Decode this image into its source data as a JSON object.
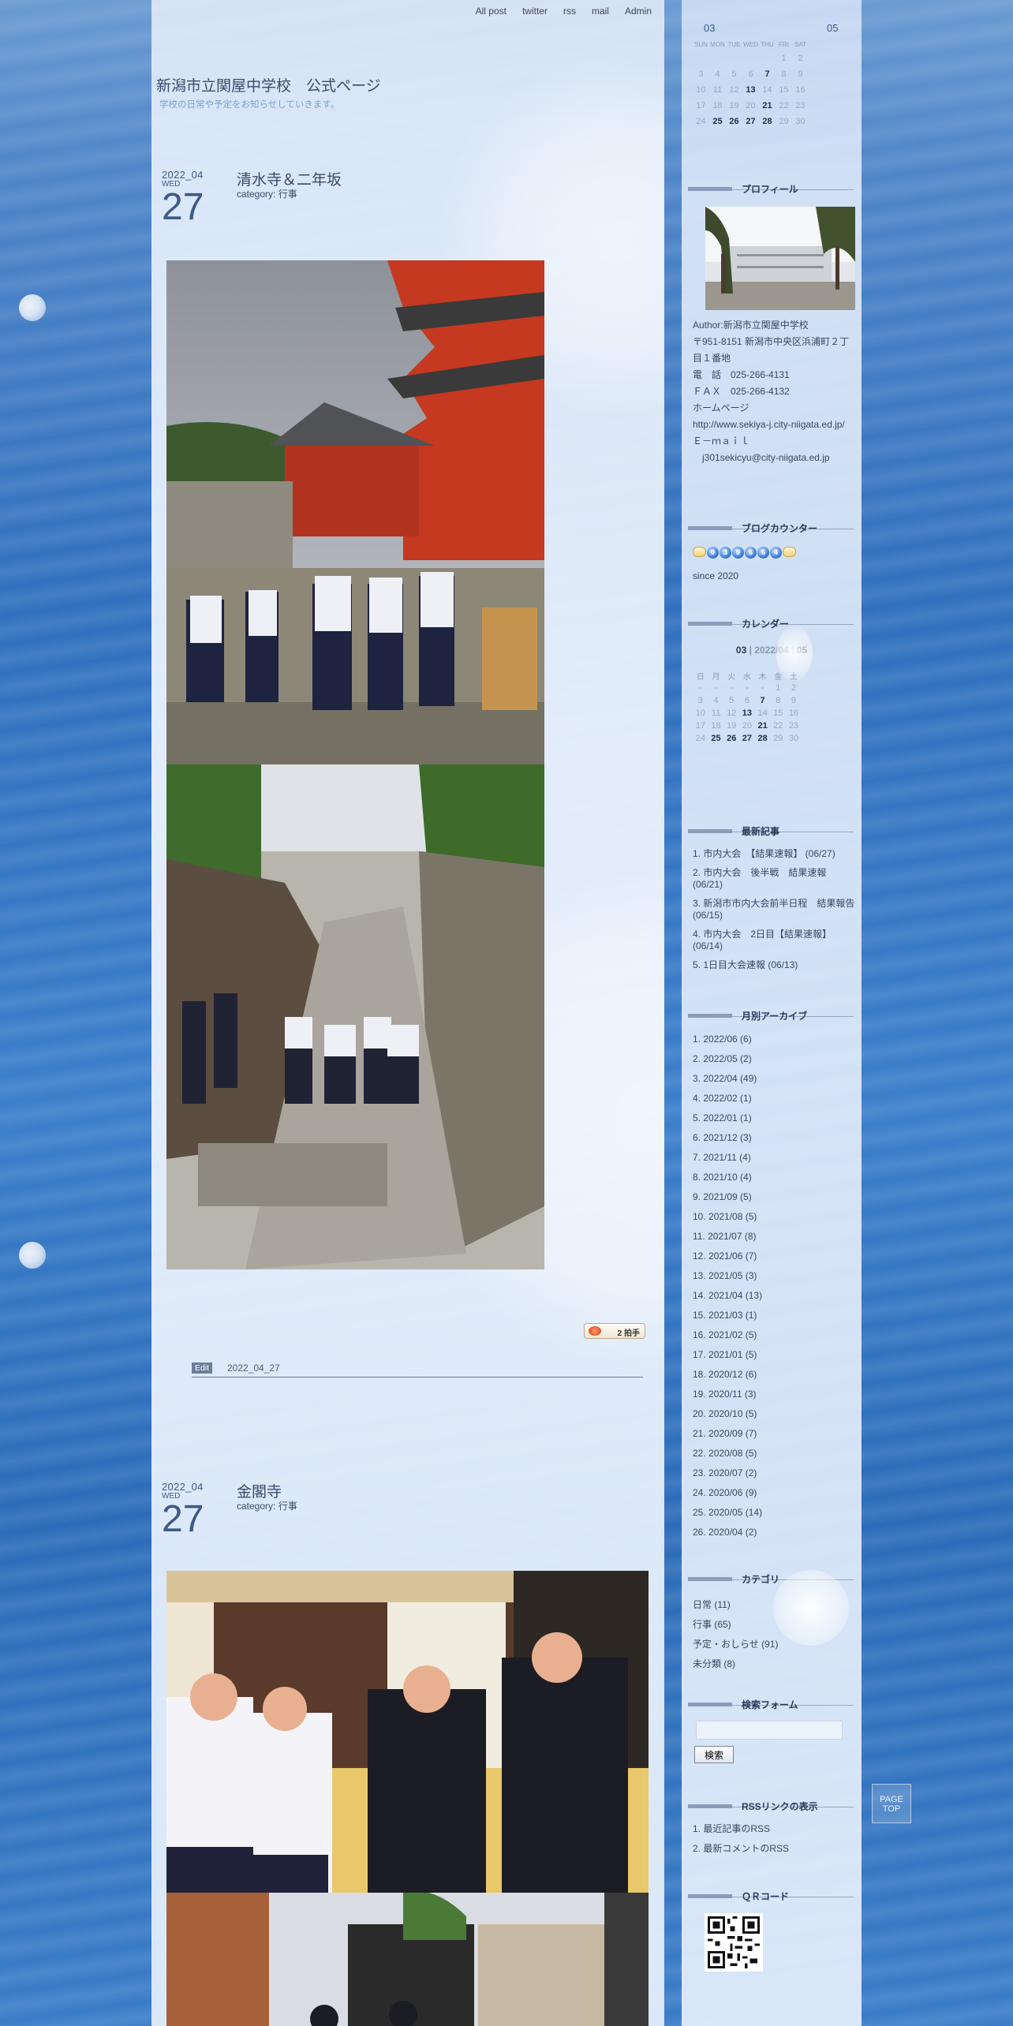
{
  "nav": [
    "All post",
    "twitter",
    "rss",
    "mail",
    "Admin"
  ],
  "site": {
    "title": "新潟市立関屋中学校　公式ページ",
    "subtitle": "学校の日常や予定をお知らせしていきます。"
  },
  "entries": [
    {
      "year_month": "2022_04",
      "weekday": "WED",
      "day": "27",
      "title": "清水寺＆二年坂",
      "category": "category: 行事",
      "counter": "2",
      "counter_unit": "拍手",
      "edit_label": "Edit",
      "footer_date": "2022_04_27"
    },
    {
      "year_month": "2022_04",
      "weekday": "WED",
      "day": "27",
      "title": "金閣寺",
      "category": "category: 行事"
    }
  ],
  "top_calendar": {
    "prev": "03",
    "next": "05",
    "weekdays": [
      "SUN",
      "MON",
      "TUE",
      "WED",
      "THU",
      "FRI",
      "SAT"
    ],
    "rows": [
      [
        "",
        "",
        "",
        "",
        "",
        "1",
        "2"
      ],
      [
        "3",
        "4",
        "5",
        "6",
        "7",
        "8",
        "9"
      ],
      [
        "10",
        "11",
        "12",
        "13",
        "14",
        "15",
        "16"
      ],
      [
        "17",
        "18",
        "19",
        "20",
        "21",
        "22",
        "23"
      ],
      [
        "24",
        "25",
        "26",
        "27",
        "28",
        "29",
        "30"
      ]
    ],
    "bold": [
      "7",
      "13",
      "21",
      "25",
      "26",
      "27",
      "28"
    ]
  },
  "sidebar": {
    "profile": {
      "heading": "プロフィール",
      "lines": [
        "Author:新潟市立関屋中学校",
        "〒951-8151 新潟市中央区浜浦町２丁目１番地",
        "電　話　025-266-4131",
        "ＦＡＸ　025-266-4132",
        "ホームページ",
        "http://www.sekiya-j.city-niigata.ed.jp/",
        "Ｅ－ｍａｉｌ",
        "　j301sekicyu@city-niigata.ed.jp"
      ]
    },
    "counter": {
      "heading": "ブログカウンター",
      "digits": [
        "0",
        "3",
        "9",
        "6",
        "6",
        "4"
      ],
      "since": "since 2020"
    },
    "calendar": {
      "heading": "カレンダー",
      "prev": "03",
      "current": "2022/04",
      "next": "05",
      "sep": "|",
      "weekdays": [
        "日",
        "月",
        "火",
        "水",
        "木",
        "金",
        "土"
      ],
      "rows": [
        [
          "-",
          "-",
          "-",
          "-",
          "-",
          "1",
          "2"
        ],
        [
          "3",
          "4",
          "5",
          "6",
          "7",
          "8",
          "9"
        ],
        [
          "10",
          "11",
          "12",
          "13",
          "14",
          "15",
          "16"
        ],
        [
          "17",
          "18",
          "19",
          "20",
          "21",
          "22",
          "23"
        ],
        [
          "24",
          "25",
          "26",
          "27",
          "28",
          "29",
          "30"
        ]
      ],
      "bold": [
        "7",
        "13",
        "21",
        "25",
        "26",
        "27",
        "28"
      ]
    },
    "recent": {
      "heading": "最新記事",
      "items": [
        "1. 市内大会　【結果速報】 (06/27)",
        "2. 市内大会　後半戦　結果速報 (06/21)",
        "3. 新潟市市内大会前半日程　結果報告 (06/15)",
        "4. 市内大会　2日目【結果速報】 (06/14)",
        "5. 1日目大会速報 (06/13)"
      ]
    },
    "archive": {
      "heading": "月別アーカイブ",
      "items": [
        "1. 2022/06 (6)",
        "2. 2022/05 (2)",
        "3. 2022/04 (49)",
        "4. 2022/02 (1)",
        "5. 2022/01 (1)",
        "6. 2021/12 (3)",
        "7. 2021/11 (4)",
        "8. 2021/10 (4)",
        "9. 2021/09 (5)",
        "10. 2021/08 (5)",
        "11. 2021/07 (8)",
        "12. 2021/06 (7)",
        "13. 2021/05 (3)",
        "14. 2021/04 (13)",
        "15. 2021/03 (1)",
        "16. 2021/02 (5)",
        "17. 2021/01 (5)",
        "18. 2020/12 (6)",
        "19. 2020/11 (3)",
        "20. 2020/10 (5)",
        "21. 2020/09 (7)",
        "22. 2020/08 (5)",
        "23. 2020/07 (2)",
        "24. 2020/06 (9)",
        "25. 2020/05 (14)",
        "26. 2020/04 (2)"
      ]
    },
    "category": {
      "heading": "カテゴリ",
      "items": [
        "日常 (11)",
        "行事 (65)",
        "予定・おしらせ (91)",
        "未分類 (8)"
      ]
    },
    "search": {
      "heading": "検索フォーム",
      "button": "検索"
    },
    "rss": {
      "heading": "RSSリンクの表示",
      "items": [
        "1. 最近記事のRSS",
        "2. 最新コメントのRSS"
      ]
    },
    "qr": {
      "heading": "ＱＲコード"
    }
  },
  "pagetop": [
    "PAGE",
    "TOP"
  ],
  "colors": {
    "accent": "#3d5a85",
    "ocean": "#2f6fbe",
    "panel": "#e6eefb"
  }
}
